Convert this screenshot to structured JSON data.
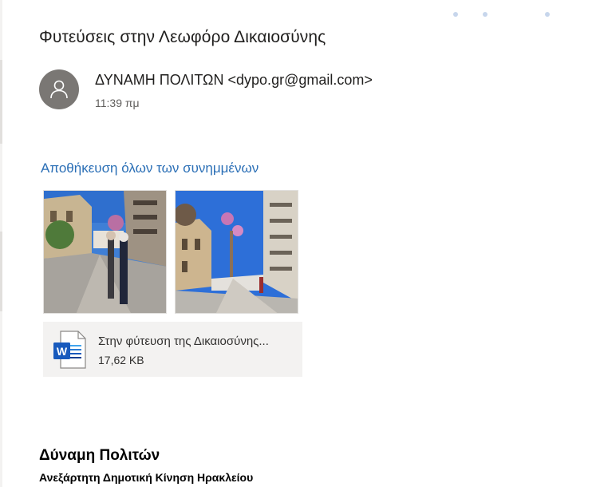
{
  "email": {
    "subject": "Φυτεύσεις στην Λεωφόρο Δικαιοσύνης",
    "sender": "ΔΥΝΑΜΗ ΠΟΛΙΤΩΝ <dypo.gr@gmail.com>",
    "time": "11:39 πμ"
  },
  "attachments": {
    "save_all_label": "Αποθήκευση όλων των συνημμένων",
    "images": [
      {
        "icon": "photo-thumbnail"
      },
      {
        "icon": "photo-thumbnail"
      }
    ],
    "file": {
      "name": "Στην φύτευση της Δικαιοσύνης...",
      "size": "17,62 KB",
      "icon": "word-document-icon"
    }
  },
  "signature": {
    "name": "Δύναμη Πολιτών",
    "subtitle": "Ανεξάρτητη Δημοτική Κίνηση Ηρακλείου"
  },
  "colors": {
    "link": "#2b6fb6",
    "avatar": "#7a7774",
    "card": "#f3f2f1",
    "word_blue": "#185abd"
  }
}
